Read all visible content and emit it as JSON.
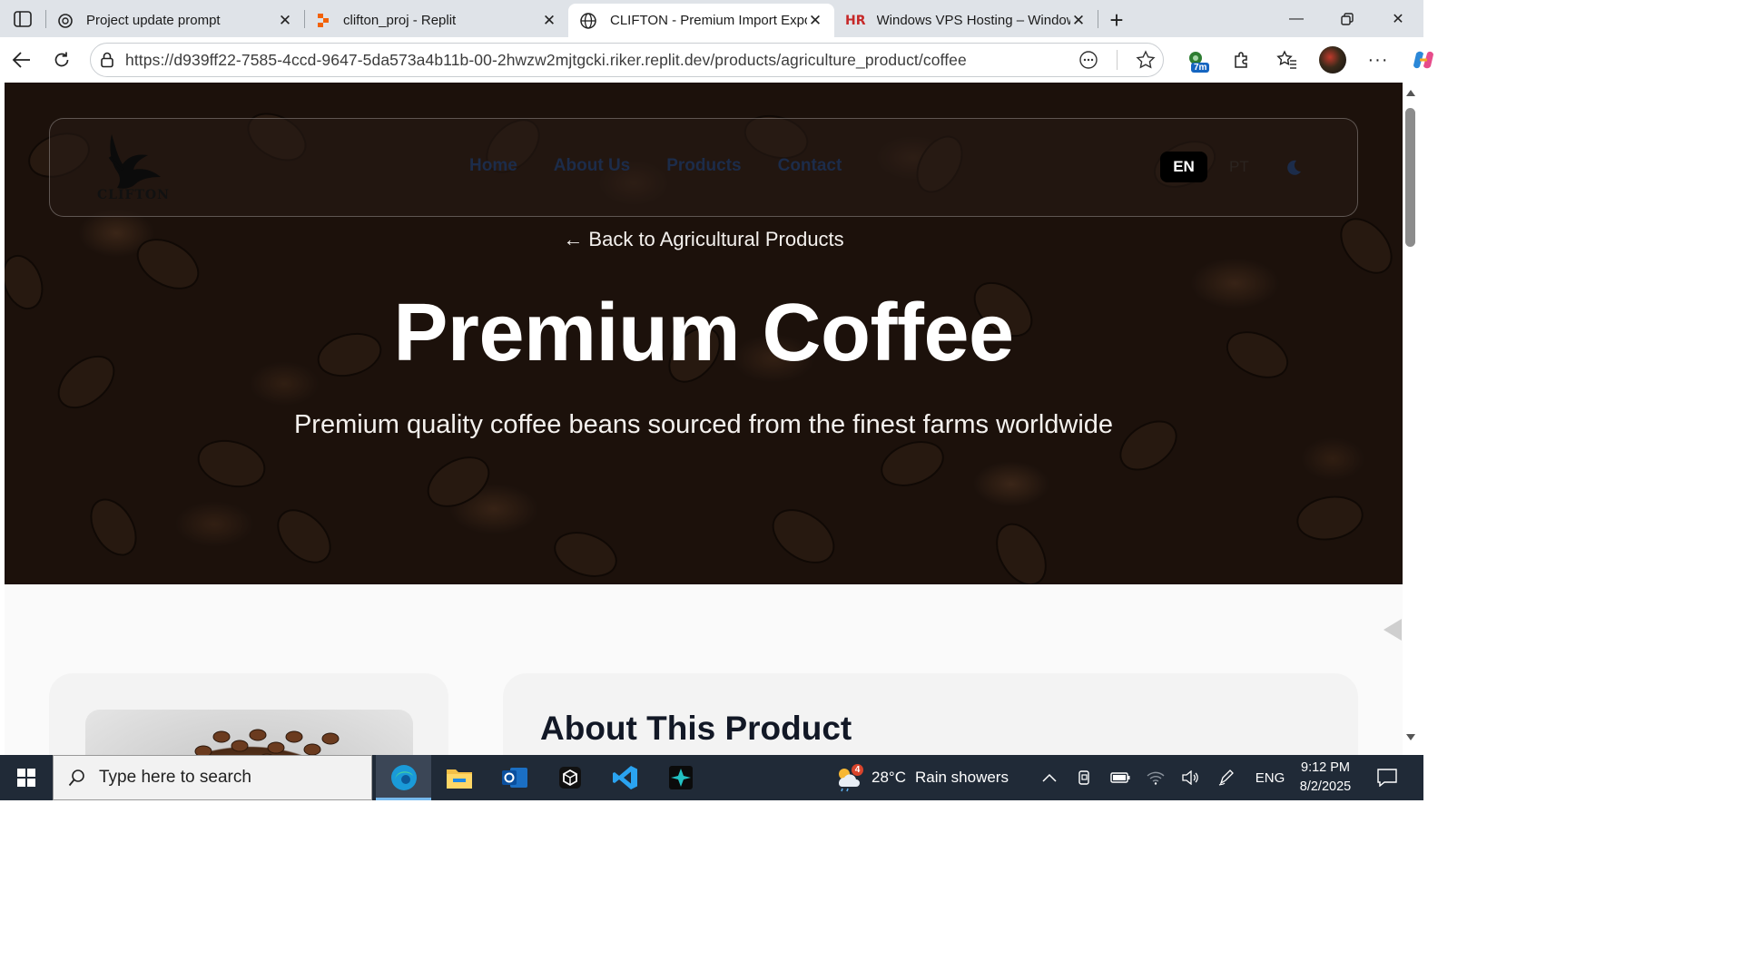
{
  "browser": {
    "tabs": [
      {
        "title": "Project update prompt",
        "icon": "chatgpt-icon"
      },
      {
        "title": "clifton_proj - Replit",
        "icon": "replit-icon"
      },
      {
        "title": "CLIFTON - Premium Import Expor",
        "icon": "globe-icon"
      },
      {
        "title": "Windows VPS Hosting – Windows",
        "icon": "hr-icon"
      }
    ],
    "url": "https://d939ff22-7585-4ccd-9647-5da573a4b11b-00-2hwzw2mjtgcki.riker.replit.dev/products/agriculture_product/coffee",
    "timer_badge": "7m"
  },
  "site": {
    "logo_text": "CLIFTON",
    "nav": [
      "Home",
      "About Us",
      "Products",
      "Contact"
    ],
    "lang_active": "EN",
    "lang_other": "PT",
    "back_link": "← Back to Agricultural Products",
    "hero_title": "Premium Coffee",
    "hero_subtitle": "Premium quality coffee beans sourced from the finest farms worldwide",
    "about_title": "About This Product"
  },
  "taskbar": {
    "search_placeholder": "Type here to search",
    "weather_temp": "28°C",
    "weather_desc": "Rain showers",
    "weather_badge": "4",
    "language": "ENG",
    "time": "9:12 PM",
    "date": "8/2/2025"
  },
  "colors": {
    "nav_link": "#1c2c4a",
    "lang_active_bg": "#000000",
    "taskbar_bg": "#202a37",
    "hero_base": "#2b1b12"
  }
}
